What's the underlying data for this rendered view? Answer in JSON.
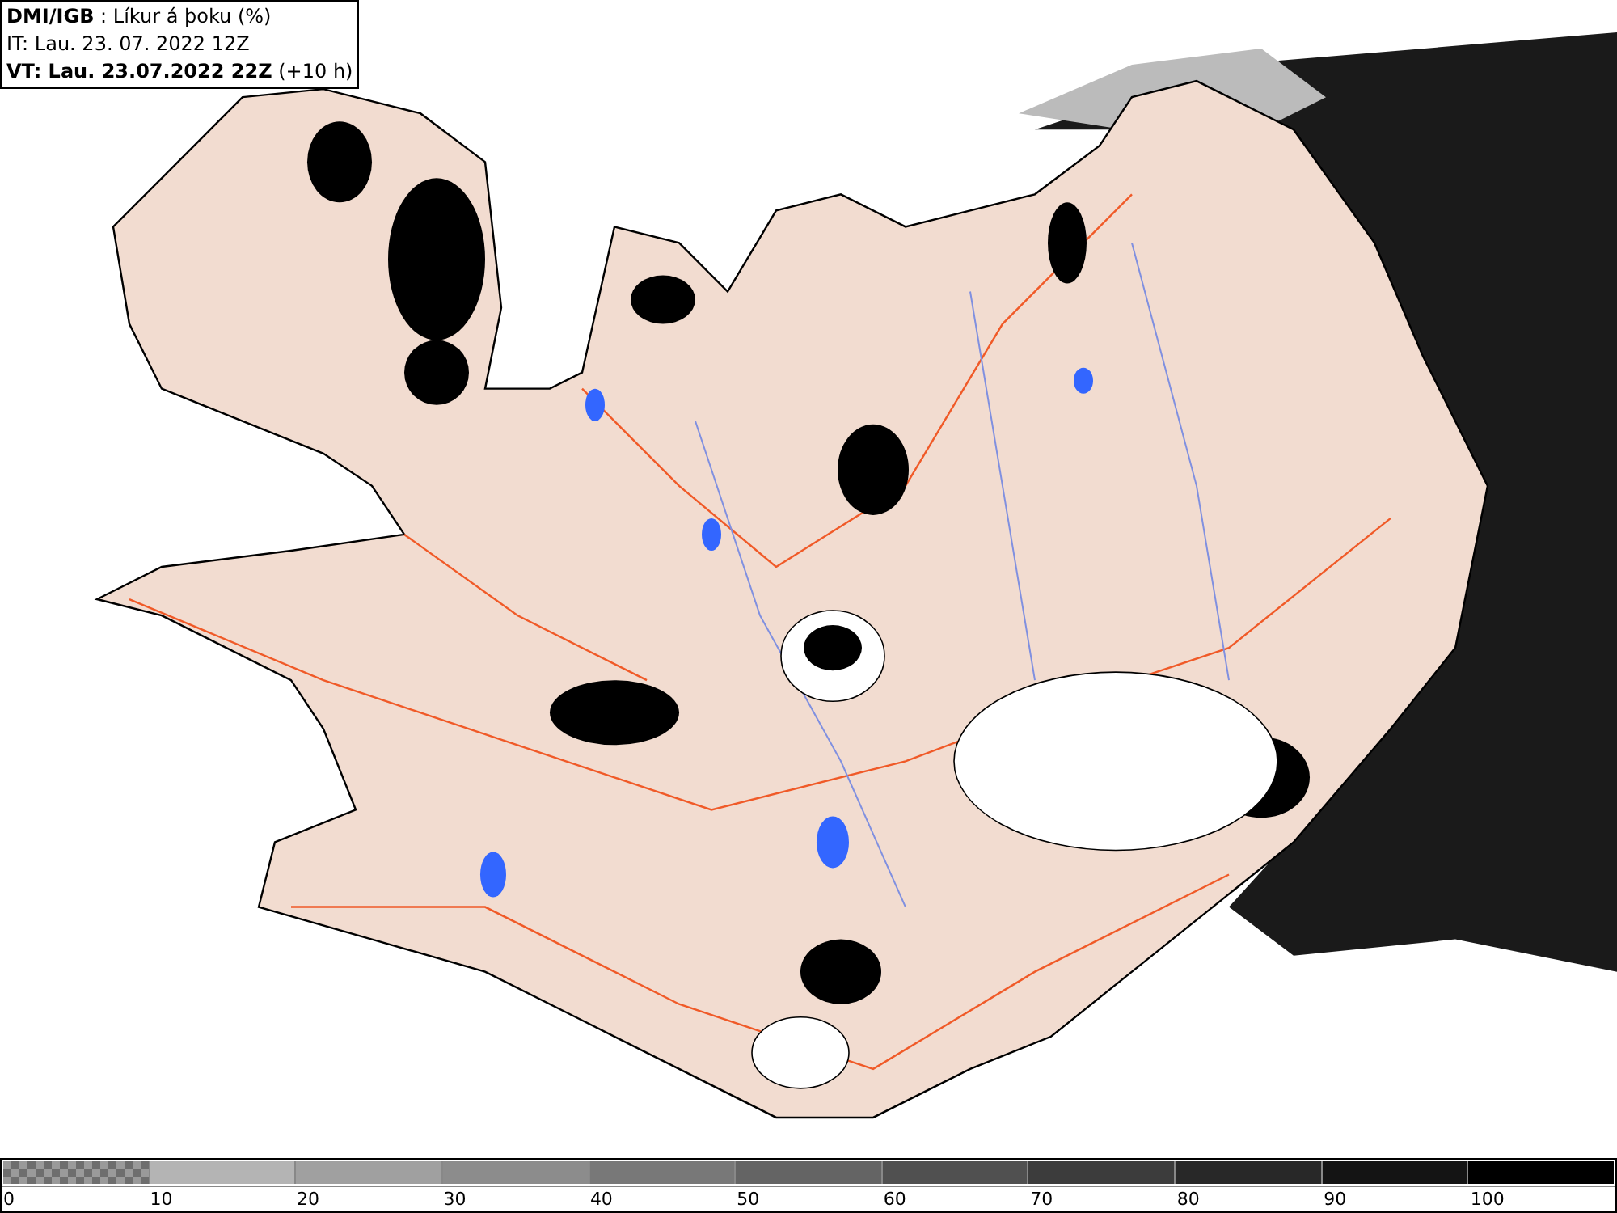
{
  "header": {
    "lines": [
      "**DMI/IGB** : Líkur á þoku (%)",
      "IT: Lau. 23. 07. 2022 12Z",
      "**VT: Lau. 23.07.2022 22Z** (+10 h)"
    ]
  },
  "legend": {
    "bins": [
      {
        "kind": "pattern",
        "color": "#9a9a9a",
        "label": "0"
      },
      {
        "kind": "solid",
        "color": "#b4b4b4",
        "label": "10"
      },
      {
        "kind": "solid",
        "color": "#a0a0a0",
        "label": "20"
      },
      {
        "kind": "solid",
        "color": "#8c8c8c",
        "label": "30"
      },
      {
        "kind": "solid",
        "color": "#787878",
        "label": "40"
      },
      {
        "kind": "solid",
        "color": "#646464",
        "label": "50"
      },
      {
        "kind": "solid",
        "color": "#505050",
        "label": "60"
      },
      {
        "kind": "solid",
        "color": "#3c3c3c",
        "label": "70"
      },
      {
        "kind": "solid",
        "color": "#282828",
        "label": "80"
      },
      {
        "kind": "solid",
        "color": "#141414",
        "label": "90"
      },
      {
        "kind": "solid",
        "color": "#000000",
        "label": "100"
      }
    ]
  }
}
